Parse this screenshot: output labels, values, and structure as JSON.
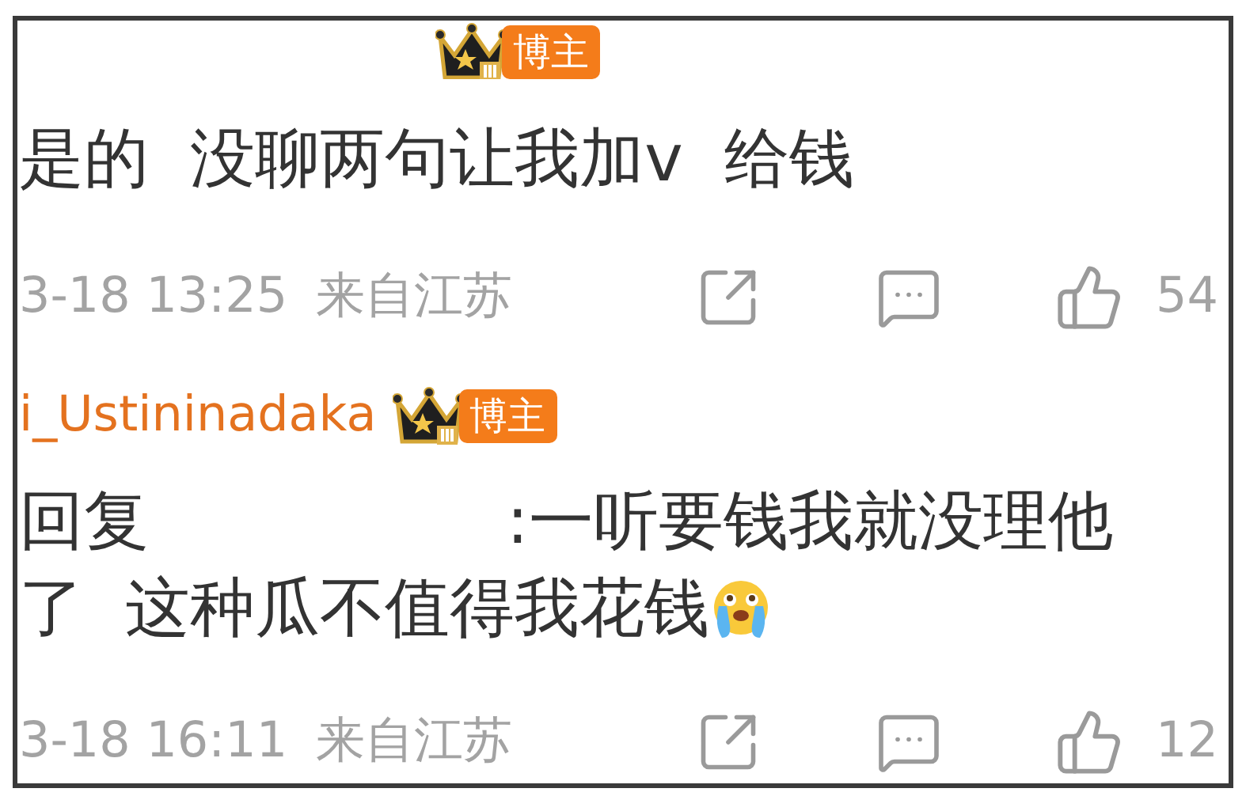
{
  "comments": [
    {
      "badge": "博主",
      "text": "是的  没聊两句让我加v  给钱",
      "time": "3-18 13:25",
      "location": "来自江苏",
      "likes": "54"
    },
    {
      "username": "i_Ustininadaka",
      "badge": "博主",
      "reply_label": "回复",
      "text_lines": [
        ":一听要钱我就没理他",
        "了  这种瓜不值得我花钱"
      ],
      "time": "3-18 16:11",
      "location": "来自江苏",
      "likes": "12"
    }
  ]
}
